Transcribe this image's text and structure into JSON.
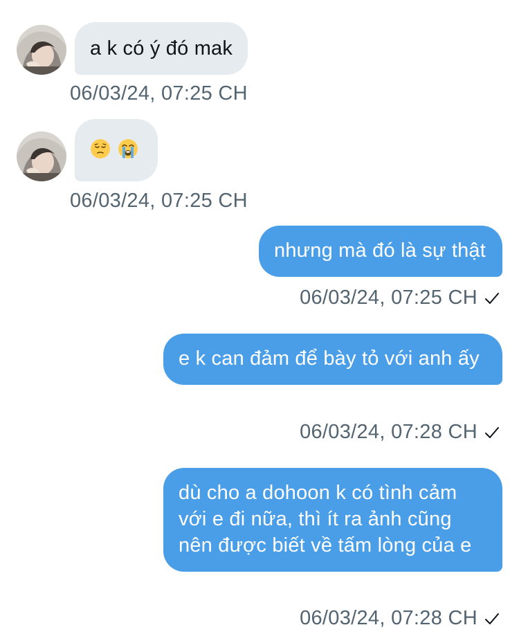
{
  "conversation": {
    "messages": [
      {
        "direction": "incoming",
        "text": "a k có ý đó mak",
        "timestamp": "06/03/24, 07:25 CH"
      },
      {
        "direction": "incoming",
        "text": "😔 😭",
        "emojis": [
          "pensive-face-emoji",
          "loudly-crying-face-emoji"
        ],
        "timestamp": "06/03/24, 07:25 CH"
      },
      {
        "direction": "outgoing",
        "text": "nhưng mà đó là sự thật",
        "timestamp": "06/03/24, 07:25 CH",
        "status_icon": "checkmark-icon"
      },
      {
        "direction": "outgoing",
        "text": "e k can đảm để bày tỏ với anh ấy",
        "timestamp": "06/03/24, 07:28 CH",
        "status_icon": "checkmark-icon"
      },
      {
        "direction": "outgoing",
        "text": "dù cho a dohoon k có tình cảm với e đi nữa, thì ít ra ảnh cũng nên được biết về tấm lòng của e",
        "timestamp": "06/03/24, 07:28 CH",
        "status_icon": "checkmark-icon"
      }
    ]
  },
  "colors": {
    "incoming_bubble": "#e6ebf0",
    "outgoing_bubble": "#4a9ee8",
    "timestamp_text": "#536471"
  }
}
